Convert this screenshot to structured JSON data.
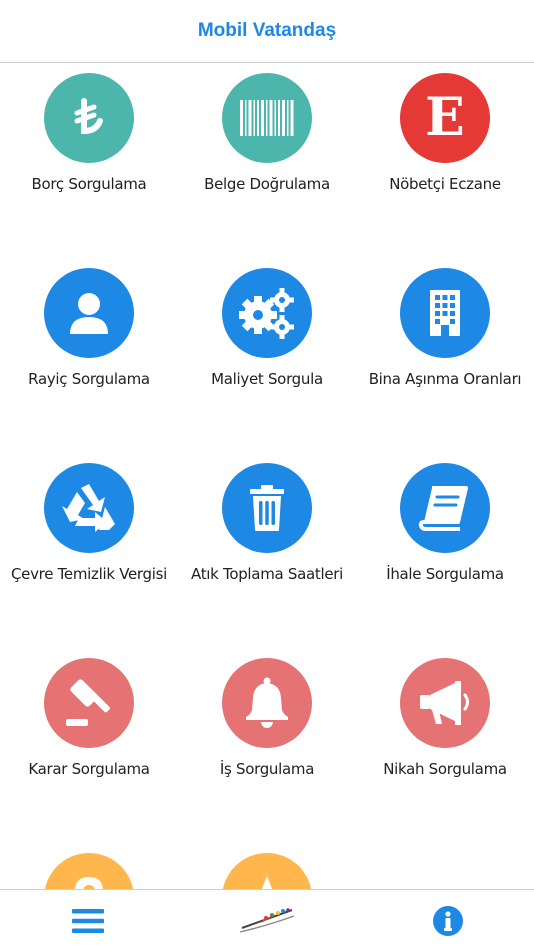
{
  "header": {
    "title": "Mobil Vatandaş"
  },
  "colors": {
    "teal": "#4db6ac",
    "red": "#e53935",
    "blue": "#1e88e5",
    "coral": "#e57373",
    "orange": "#ffb74d",
    "accent": "#1e88e5"
  },
  "tiles": [
    {
      "label": "Borç Sorgulama",
      "icon": "lira-icon",
      "color": "#4db6ac"
    },
    {
      "label": "Belge Doğrulama",
      "icon": "barcode-icon",
      "color": "#4db6ac"
    },
    {
      "label": "Nöbetçi Eczane",
      "icon": "letter-e-icon",
      "color": "#e53935"
    },
    {
      "label": "Rayiç Sorgulama",
      "icon": "user-icon",
      "color": "#1e88e5"
    },
    {
      "label": "Maliyet Sorgula",
      "icon": "gears-icon",
      "color": "#1e88e5"
    },
    {
      "label": "Bina Aşınma Oranları",
      "icon": "building-icon",
      "color": "#1e88e5"
    },
    {
      "label": "Çevre Temizlik Vergisi",
      "icon": "recycle-icon",
      "color": "#1e88e5"
    },
    {
      "label": "Atık Toplama Saatleri",
      "icon": "trash-icon",
      "color": "#1e88e5"
    },
    {
      "label": "İhale Sorgulama",
      "icon": "book-icon",
      "color": "#1e88e5"
    },
    {
      "label": "Karar Sorgulama",
      "icon": "gavel-icon",
      "color": "#e57373"
    },
    {
      "label": "İş Sorgulama",
      "icon": "bell-icon",
      "color": "#e57373"
    },
    {
      "label": "Nikah Sorgulama",
      "icon": "megaphone-icon",
      "color": "#e57373"
    },
    {
      "label": "",
      "icon": "location-icon",
      "color": "#ffb74d"
    },
    {
      "label": "",
      "icon": "star-icon",
      "color": "#ffb74d"
    }
  ],
  "bottom_bar": {
    "menu_icon": "menu-icon",
    "logo_icon": "logo-icon",
    "info_icon": "info-icon"
  }
}
